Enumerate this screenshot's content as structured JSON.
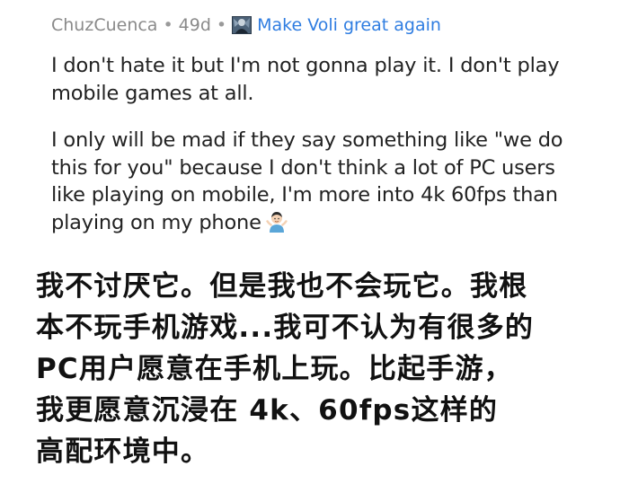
{
  "comment": {
    "username": "ChuzCuenca",
    "separator": "•",
    "age": "49d",
    "flair": "Make Voli great again",
    "flair_icon": "avatar-flair-icon",
    "paragraph_1": "I don't hate it but I'm not gonna play it. I don't play mobile games at all.",
    "paragraph_2": "I only will be mad if they say something like \"we do this for you\" because I don't think a lot of PC users like playing on mobile, I'm more into 4k 60fps than playing on my phone",
    "emoji": "man-shrugging-emoji"
  },
  "translation": {
    "lines": [
      "我不讨厌它。但是我也不会玩它。我根",
      "本不玩手机游戏...我可不认为有很多的",
      "PC用户愿意在手机上玩。比起手游，",
      "我更愿意沉浸在 4k、60fps这样的",
      "高配环境中。"
    ]
  },
  "colors": {
    "meta": "#8a8a8a",
    "flair": "#2f7de1",
    "body": "#222222",
    "translation": "#111111"
  }
}
